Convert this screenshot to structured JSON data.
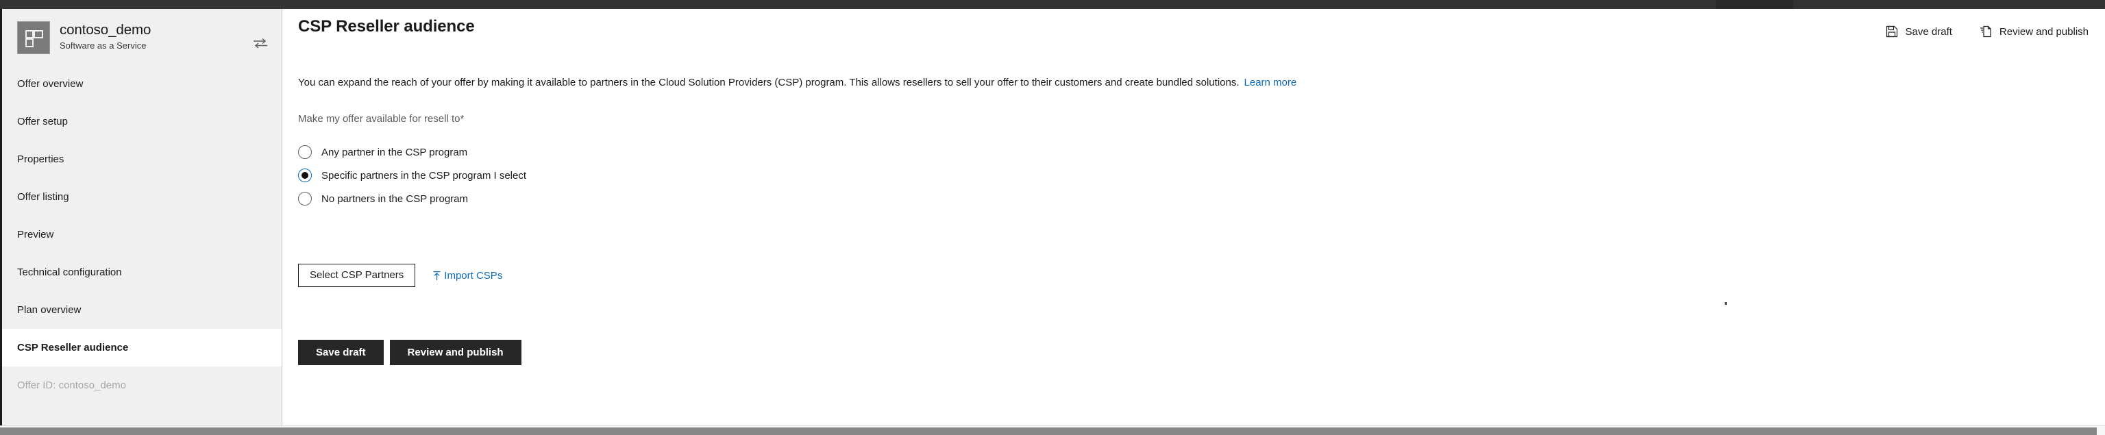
{
  "window": {
    "topbar_color": "#333333"
  },
  "sidebar": {
    "offer": {
      "name": "contoso_demo",
      "type": "Software as a Service",
      "icon": "offer-grid-icon",
      "swap_icon": "swap-arrows-icon"
    },
    "items": [
      {
        "label": "Offer overview",
        "selected": false
      },
      {
        "label": "Offer setup",
        "selected": false
      },
      {
        "label": "Properties",
        "selected": false
      },
      {
        "label": "Offer listing",
        "selected": false
      },
      {
        "label": "Preview",
        "selected": false
      },
      {
        "label": "Technical configuration",
        "selected": false
      },
      {
        "label": "Plan overview",
        "selected": false
      },
      {
        "label": "CSP Reseller audience",
        "selected": true
      }
    ],
    "footer": "Offer ID: contoso_demo"
  },
  "main": {
    "title": "CSP Reseller audience",
    "intro_text": "You can expand the reach of your offer by making it available to partners in the Cloud Solution Providers (CSP) program. This allows resellers to sell your offer to their customers and create bundled solutions.",
    "learn_more": "Learn more",
    "field_label": "Make my offer available for resell to*",
    "radios": [
      {
        "label": "Any partner in the CSP program",
        "checked": false
      },
      {
        "label": "Specific partners in the CSP program I select",
        "checked": true
      },
      {
        "label": "No partners in the CSP program",
        "checked": false
      }
    ],
    "select_partners_button": "Select CSP Partners",
    "import_link": "Import CSPs",
    "import_icon": "upload-arrow-icon",
    "bottom_buttons": {
      "save_draft": "Save draft",
      "review_publish": "Review and publish"
    }
  },
  "command_bar": {
    "save_draft": "Save draft",
    "save_draft_icon": "save-disk-icon",
    "review_publish": "Review and publish",
    "review_publish_icon": "publish-document-icon"
  },
  "colors": {
    "link": "#0f6cbd",
    "accent_radio": "#0f6cbd",
    "dark_button": "#272727",
    "sidebar_bg": "#f0f0f0",
    "topbar": "#333333"
  }
}
